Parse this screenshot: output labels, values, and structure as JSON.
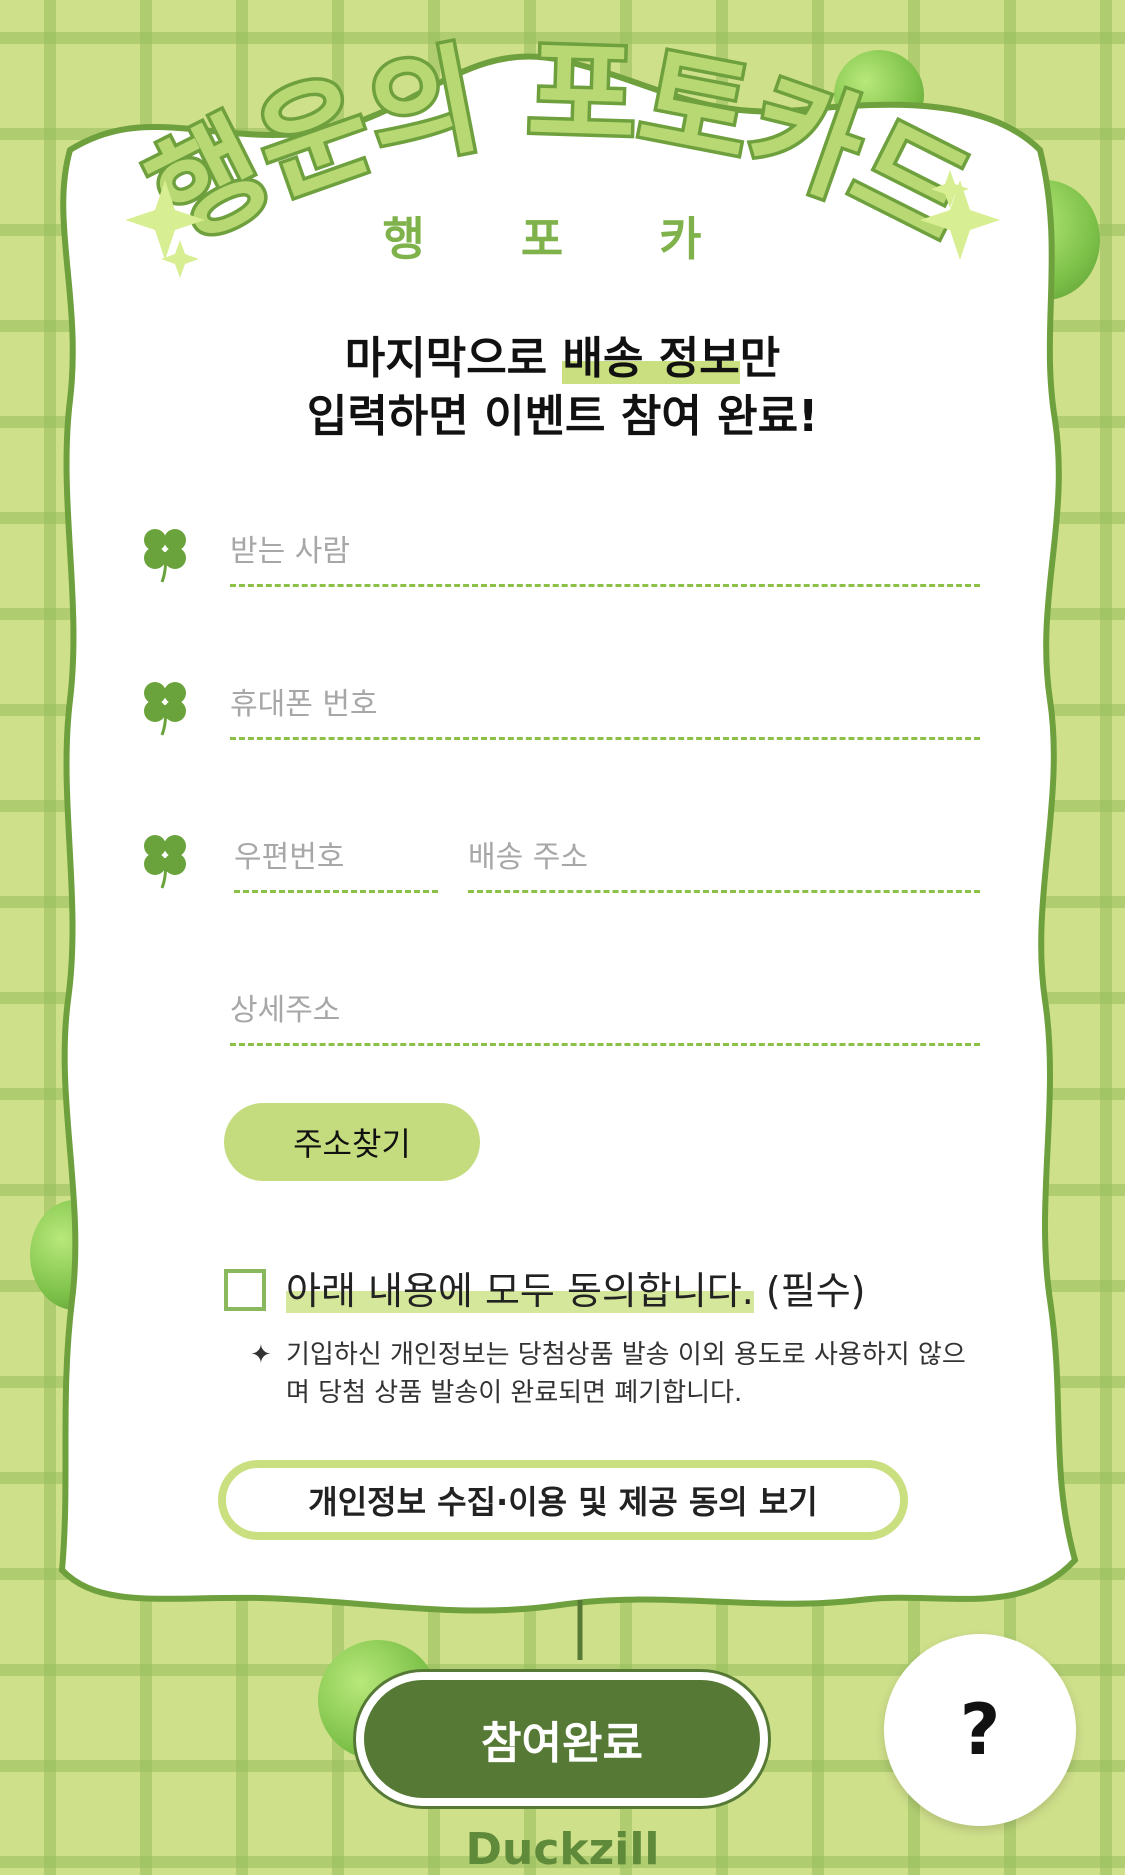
{
  "header": {
    "title": "행운의 포토카드",
    "subtitle": "행 포 카"
  },
  "headline": {
    "line1_pre": "마지막으로 ",
    "line1_highlight": "배송 정보",
    "line1_post": "만",
    "line2": "입력하면 이벤트 참여 완료!"
  },
  "form": {
    "recipient_placeholder": "받는 사람",
    "phone_placeholder": "휴대폰 번호",
    "zip_placeholder": "우편번호",
    "address_placeholder": "배송 주소",
    "detail_placeholder": "상세주소",
    "find_address_label": "주소찾기"
  },
  "agreement": {
    "label_highlight": "아래 내용에 모두 동의합니다.",
    "label_required": " (필수)",
    "notice_star": "✦",
    "notice_text": "기입하신 개인정보는 당첨상품 발송 이외 용도로 사용하지 않으며 당첨 상품 발송이 완료되면 폐기합니다.",
    "privacy_button": "개인정보 수집·이용 및 제공 동의 보기"
  },
  "actions": {
    "submit_label": "참여완료",
    "help_label": "?"
  },
  "brand": "Duckzill",
  "colors": {
    "background": "#cfe08b",
    "accent_green": "#8cc046",
    "dark_green": "#567a35",
    "light_green": "#c9df80"
  },
  "icons": {
    "field_marker": "clover-icon",
    "decor": "sparkle-icon"
  }
}
